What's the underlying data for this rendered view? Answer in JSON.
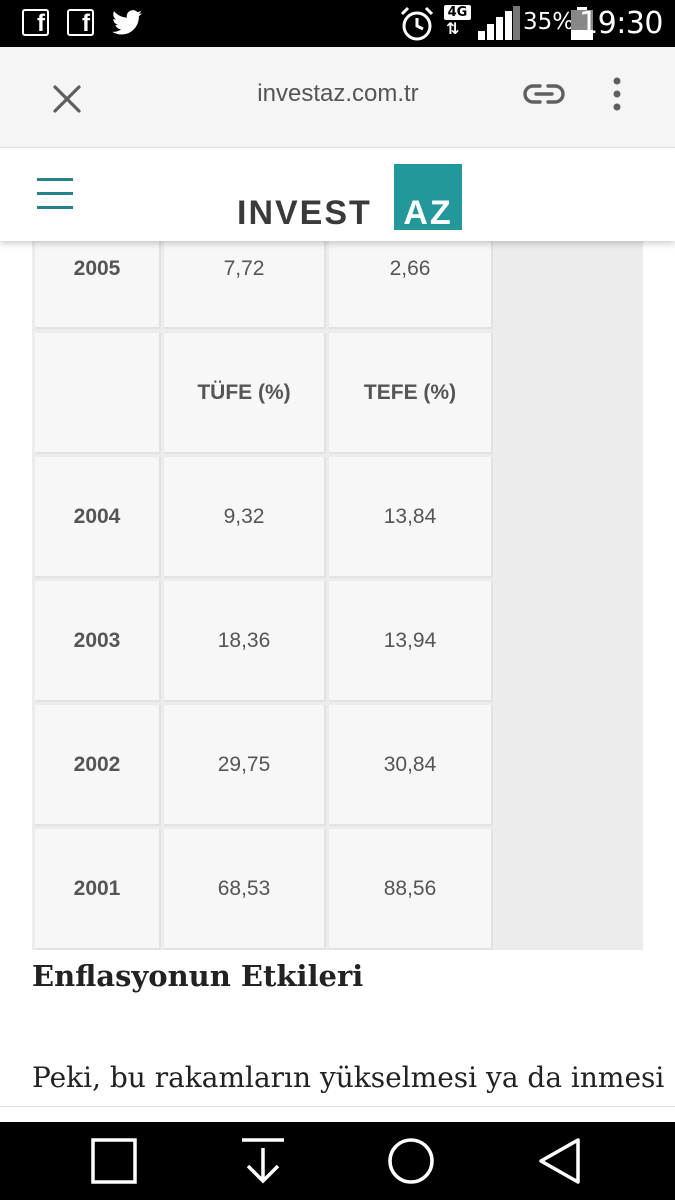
{
  "status_bar": {
    "time": "19:30",
    "battery_percent": "35%",
    "network_type": "4G",
    "battery_level": 0.35,
    "notification_icons": [
      "facebook-icon",
      "facebook-icon",
      "twitter-icon"
    ],
    "system_icons": [
      "alarm-icon",
      "network-4g-icon",
      "signal-icon",
      "battery-icon"
    ]
  },
  "browser": {
    "url": "investaz.com.tr",
    "icons": [
      "close-icon",
      "link-icon",
      "more-vert-icon"
    ]
  },
  "site_header": {
    "logo_left": "INVEST",
    "logo_right": "AZ",
    "brand_color": "#22989a",
    "menu_icon": "hamburger-icon"
  },
  "table": {
    "header_row": {
      "year": "",
      "tufe": "TÜFE (%)",
      "tefe": "TEFE  (%)"
    },
    "rows": [
      {
        "year": "2005",
        "tufe": "7,72",
        "tefe": "2,66"
      },
      {
        "year": "2004",
        "tufe": "9,32",
        "tefe": "13,84"
      },
      {
        "year": "2003",
        "tufe": "18,36",
        "tefe": "13,94"
      },
      {
        "year": "2002",
        "tufe": "29,75",
        "tefe": "30,84"
      },
      {
        "year": "2001",
        "tufe": "68,53",
        "tefe": "88,56"
      }
    ]
  },
  "article": {
    "section_title": "Enflasyonun Etkileri",
    "body_text": "Peki, bu rakamların yükselmesi ya da inmesi"
  },
  "nav_bar": {
    "buttons": [
      "recents-icon",
      "download-icon",
      "home-icon",
      "back-icon"
    ]
  }
}
